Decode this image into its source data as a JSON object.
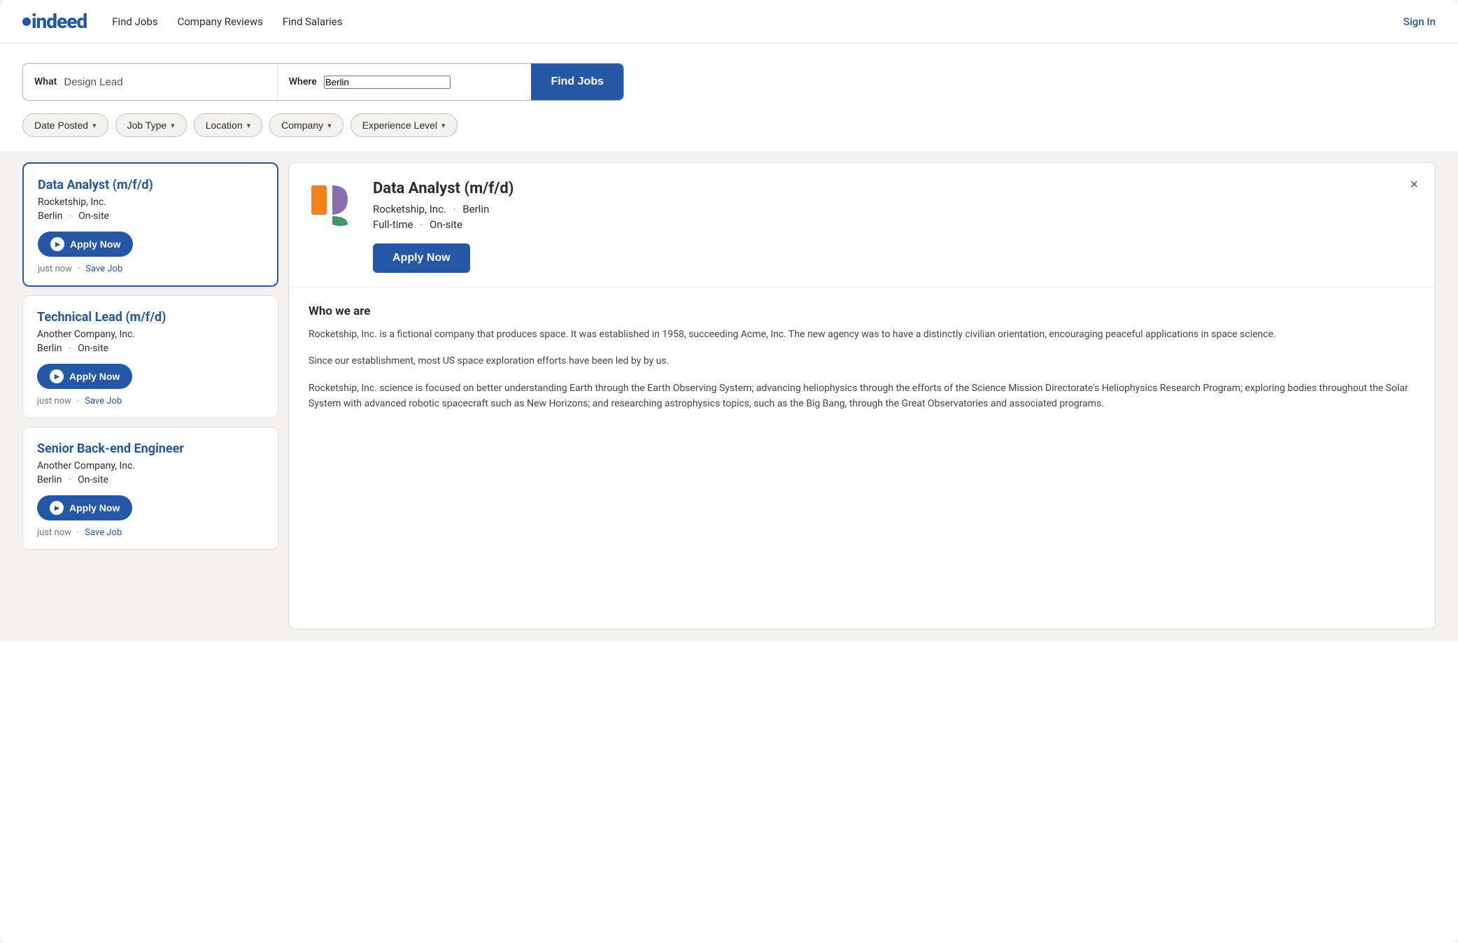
{
  "header": {
    "logo_text": "indeed",
    "nav_items": [
      "Find Jobs",
      "Company Reviews",
      "Find Salaries"
    ],
    "sign_in": "Sign In"
  },
  "search": {
    "what_label": "What",
    "what_value": "Design Lead",
    "where_label": "Where",
    "where_value": "Berlin",
    "find_jobs_label": "Find Jobs"
  },
  "filters": [
    {
      "label": "Date Posted",
      "id": "date-posted"
    },
    {
      "label": "Job Type",
      "id": "job-type"
    },
    {
      "label": "Location",
      "id": "location"
    },
    {
      "label": "Company",
      "id": "company"
    },
    {
      "label": "Experience Level",
      "id": "experience-level"
    }
  ],
  "jobs": [
    {
      "id": "job-1",
      "title": "Data Analyst (m/f/d)",
      "company": "Rocketship, Inc.",
      "location": "Berlin",
      "work_type": "On-site",
      "apply_label": "Apply Now",
      "posted": "just now",
      "save_label": "Save Job",
      "selected": true
    },
    {
      "id": "job-2",
      "title": "Technical Lead (m/f/d)",
      "company": "Another Company, Inc.",
      "location": "Berlin",
      "work_type": "On-site",
      "apply_label": "Apply Now",
      "posted": "just now",
      "save_label": "Save Job",
      "selected": false
    },
    {
      "id": "job-3",
      "title": "Senior Back-end Engineer",
      "company": "Another Company, Inc.",
      "location": "Berlin",
      "work_type": "On-site",
      "apply_label": "Apply Now",
      "posted": "just now",
      "save_label": "Save Job",
      "selected": false
    }
  ],
  "detail": {
    "title": "Data Analyst (m/f/d)",
    "company": "Rocketship, Inc.",
    "location": "Berlin",
    "job_type": "Full-time",
    "work_type": "On-site",
    "apply_label": "Apply Now",
    "close_icon": "×",
    "who_we_are_title": "Who we are",
    "who_we_are_p1": "Rocketship, Inc. is a fictional company that produces space. It was established in 1958, succeeding Acme, Inc. The new agency was to have a distinctly civilian orientation, encouraging peaceful applications in space science.",
    "who_we_are_p2": "Since our establishment, most US space exploration efforts have been led by by us.",
    "who_we_are_p3": "Rocketship, Inc. science is focused on better understanding Earth through the Earth Observing System; advancing heliophysics through the efforts of the Science Mission Directorate's Heliophysics Research Program; exploring bodies throughout the Solar System with advanced robotic spacecraft such as New Horizons; and researching astrophysics topics, such as the Big Bang, through the Great Observatories and associated programs."
  }
}
